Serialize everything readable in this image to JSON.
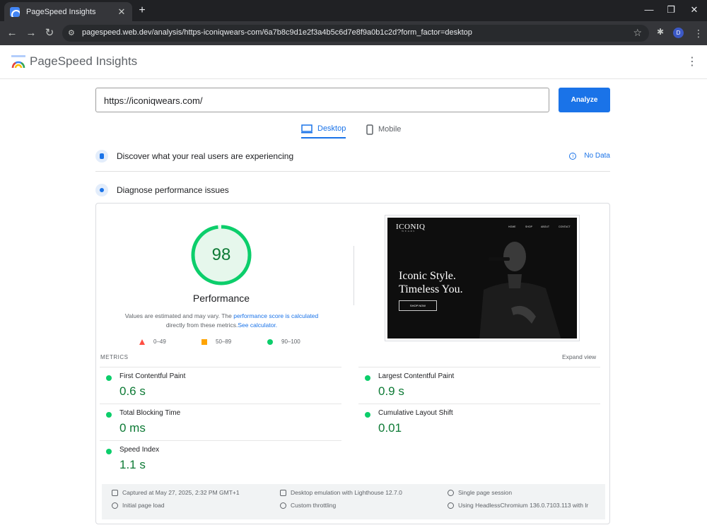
{
  "browser": {
    "tab_title": "PageSpeed Insights",
    "tab_close": "✕",
    "new_tab": "+",
    "url": "pagespeed.web.dev/analysis/https-iconiqwears-com/6a7b8c9d1e2f3a4b5c6d7e8f9a0b1c2d?form_factor=desktop",
    "profile_initial": "D",
    "window_controls": [
      "—",
      "❐",
      "✕"
    ]
  },
  "app": {
    "logo_text": "PageSpeed Insights",
    "menu": "⋮"
  },
  "search": {
    "url_value": "https://iconiqwears.com/",
    "analyze_label": "Analyze"
  },
  "tabs": {
    "desktop": "Desktop",
    "mobile": "Mobile"
  },
  "sections": {
    "real_users": "Discover what your real users are experiencing",
    "no_data": "No Data",
    "diagnose": "Diagnose performance issues"
  },
  "performance": {
    "score": "98",
    "score_value": 98,
    "label": "Performance",
    "note_prefix": "Values are estimated and may vary. The ",
    "note_link1": "performance score is calculated",
    "note_mid": " directly from these metrics.",
    "note_link2": "See calculator.",
    "legend": [
      "0–49",
      "50–89",
      "90–100"
    ]
  },
  "screenshot": {
    "brand": "ICONIQ",
    "brand_sub": "WEARS",
    "nav": [
      "HOME",
      "SHOP",
      "ABOUT",
      "CONTACT"
    ],
    "headline_1": "Iconic Style.",
    "headline_2": "Timeless You.",
    "cta": "SHOP NOW"
  },
  "metrics": {
    "heading": "METRICS",
    "expand": "Expand view",
    "items": [
      {
        "name": "First Contentful Paint",
        "value": "0.6 s"
      },
      {
        "name": "Largest Contentful Paint",
        "value": "0.9 s"
      },
      {
        "name": "Total Blocking Time",
        "value": "0 ms"
      },
      {
        "name": "Cumulative Layout Shift",
        "value": "0.01"
      },
      {
        "name": "Speed Index",
        "value": "1.1 s"
      }
    ]
  },
  "footer": {
    "captured": "Captured at May 27, 2025, 2:32 PM GMT+1",
    "emulation": "Desktop emulation with Lighthouse 12.7.0",
    "session": "Single page session",
    "initial_load": "Initial page load",
    "throttling": "Custom throttling",
    "browser": "Using HeadlessChromium 136.0.7103.113 with lr"
  },
  "colors": {
    "accent": "#1a73e8",
    "pass": "#0cce6b",
    "pass_text": "#0d7a35",
    "average": "#ffa400",
    "fail": "#ff4e42"
  }
}
